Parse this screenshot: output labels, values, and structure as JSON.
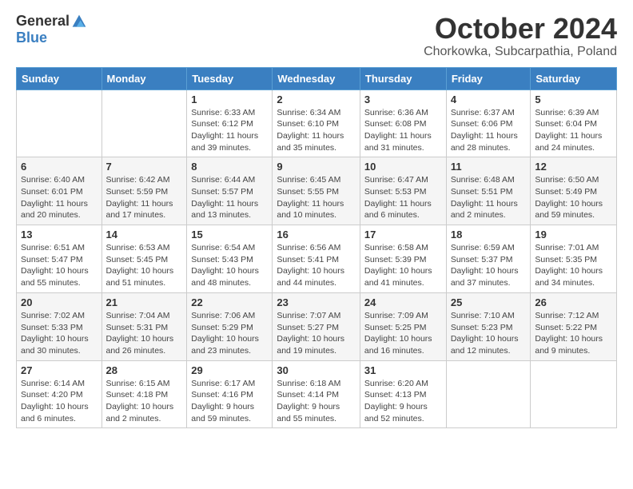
{
  "header": {
    "logo_general": "General",
    "logo_blue": "Blue",
    "main_title": "October 2024",
    "subtitle": "Chorkowka, Subcarpathia, Poland"
  },
  "days_of_week": [
    "Sunday",
    "Monday",
    "Tuesday",
    "Wednesday",
    "Thursday",
    "Friday",
    "Saturday"
  ],
  "weeks": [
    [
      {
        "day": "",
        "info": ""
      },
      {
        "day": "",
        "info": ""
      },
      {
        "day": "1",
        "info": "Sunrise: 6:33 AM\nSunset: 6:12 PM\nDaylight: 11 hours and 39 minutes."
      },
      {
        "day": "2",
        "info": "Sunrise: 6:34 AM\nSunset: 6:10 PM\nDaylight: 11 hours and 35 minutes."
      },
      {
        "day": "3",
        "info": "Sunrise: 6:36 AM\nSunset: 6:08 PM\nDaylight: 11 hours and 31 minutes."
      },
      {
        "day": "4",
        "info": "Sunrise: 6:37 AM\nSunset: 6:06 PM\nDaylight: 11 hours and 28 minutes."
      },
      {
        "day": "5",
        "info": "Sunrise: 6:39 AM\nSunset: 6:04 PM\nDaylight: 11 hours and 24 minutes."
      }
    ],
    [
      {
        "day": "6",
        "info": "Sunrise: 6:40 AM\nSunset: 6:01 PM\nDaylight: 11 hours and 20 minutes."
      },
      {
        "day": "7",
        "info": "Sunrise: 6:42 AM\nSunset: 5:59 PM\nDaylight: 11 hours and 17 minutes."
      },
      {
        "day": "8",
        "info": "Sunrise: 6:44 AM\nSunset: 5:57 PM\nDaylight: 11 hours and 13 minutes."
      },
      {
        "day": "9",
        "info": "Sunrise: 6:45 AM\nSunset: 5:55 PM\nDaylight: 11 hours and 10 minutes."
      },
      {
        "day": "10",
        "info": "Sunrise: 6:47 AM\nSunset: 5:53 PM\nDaylight: 11 hours and 6 minutes."
      },
      {
        "day": "11",
        "info": "Sunrise: 6:48 AM\nSunset: 5:51 PM\nDaylight: 11 hours and 2 minutes."
      },
      {
        "day": "12",
        "info": "Sunrise: 6:50 AM\nSunset: 5:49 PM\nDaylight: 10 hours and 59 minutes."
      }
    ],
    [
      {
        "day": "13",
        "info": "Sunrise: 6:51 AM\nSunset: 5:47 PM\nDaylight: 10 hours and 55 minutes."
      },
      {
        "day": "14",
        "info": "Sunrise: 6:53 AM\nSunset: 5:45 PM\nDaylight: 10 hours and 51 minutes."
      },
      {
        "day": "15",
        "info": "Sunrise: 6:54 AM\nSunset: 5:43 PM\nDaylight: 10 hours and 48 minutes."
      },
      {
        "day": "16",
        "info": "Sunrise: 6:56 AM\nSunset: 5:41 PM\nDaylight: 10 hours and 44 minutes."
      },
      {
        "day": "17",
        "info": "Sunrise: 6:58 AM\nSunset: 5:39 PM\nDaylight: 10 hours and 41 minutes."
      },
      {
        "day": "18",
        "info": "Sunrise: 6:59 AM\nSunset: 5:37 PM\nDaylight: 10 hours and 37 minutes."
      },
      {
        "day": "19",
        "info": "Sunrise: 7:01 AM\nSunset: 5:35 PM\nDaylight: 10 hours and 34 minutes."
      }
    ],
    [
      {
        "day": "20",
        "info": "Sunrise: 7:02 AM\nSunset: 5:33 PM\nDaylight: 10 hours and 30 minutes."
      },
      {
        "day": "21",
        "info": "Sunrise: 7:04 AM\nSunset: 5:31 PM\nDaylight: 10 hours and 26 minutes."
      },
      {
        "day": "22",
        "info": "Sunrise: 7:06 AM\nSunset: 5:29 PM\nDaylight: 10 hours and 23 minutes."
      },
      {
        "day": "23",
        "info": "Sunrise: 7:07 AM\nSunset: 5:27 PM\nDaylight: 10 hours and 19 minutes."
      },
      {
        "day": "24",
        "info": "Sunrise: 7:09 AM\nSunset: 5:25 PM\nDaylight: 10 hours and 16 minutes."
      },
      {
        "day": "25",
        "info": "Sunrise: 7:10 AM\nSunset: 5:23 PM\nDaylight: 10 hours and 12 minutes."
      },
      {
        "day": "26",
        "info": "Sunrise: 7:12 AM\nSunset: 5:22 PM\nDaylight: 10 hours and 9 minutes."
      }
    ],
    [
      {
        "day": "27",
        "info": "Sunrise: 6:14 AM\nSunset: 4:20 PM\nDaylight: 10 hours and 6 minutes."
      },
      {
        "day": "28",
        "info": "Sunrise: 6:15 AM\nSunset: 4:18 PM\nDaylight: 10 hours and 2 minutes."
      },
      {
        "day": "29",
        "info": "Sunrise: 6:17 AM\nSunset: 4:16 PM\nDaylight: 9 hours and 59 minutes."
      },
      {
        "day": "30",
        "info": "Sunrise: 6:18 AM\nSunset: 4:14 PM\nDaylight: 9 hours and 55 minutes."
      },
      {
        "day": "31",
        "info": "Sunrise: 6:20 AM\nSunset: 4:13 PM\nDaylight: 9 hours and 52 minutes."
      },
      {
        "day": "",
        "info": ""
      },
      {
        "day": "",
        "info": ""
      }
    ]
  ]
}
